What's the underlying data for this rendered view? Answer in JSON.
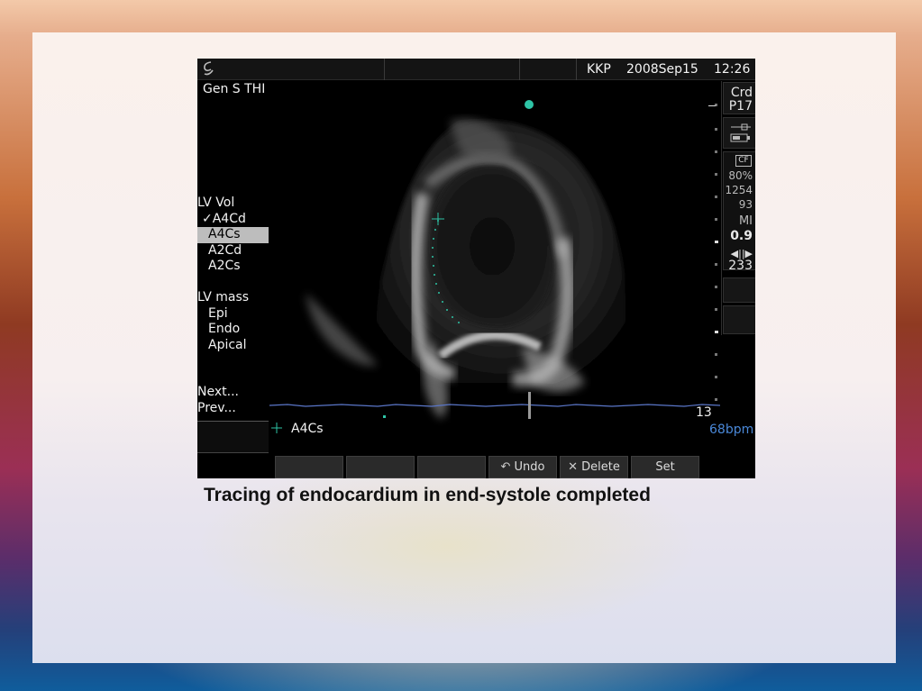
{
  "screen": {
    "operator": "KKP",
    "date": "2008Sep15",
    "time": "12:26",
    "mode": "Gen S THI",
    "menu": {
      "group1": {
        "title": "LV Vol",
        "items": [
          "✓A4Cd",
          "A4Cs",
          "A2Cd",
          "A2Cs"
        ],
        "selected": "A4Cs"
      },
      "group2": {
        "title": "LV mass",
        "items": [
          "Epi",
          "Endo",
          "Apical"
        ]
      },
      "nav": [
        "Next...",
        "Prev..."
      ]
    },
    "sidebar": {
      "preset": "Crd",
      "probe": "P17",
      "cf_label": "CF",
      "cf_values": [
        "80%",
        "1254",
        "93"
      ],
      "mi_label": "MI",
      "mi_value": "0.9",
      "depth_icon": "◀||▶",
      "depth_value": "233"
    },
    "cursor_label": "A4Cs",
    "frame_number": "13",
    "heart_rate": "68bpm",
    "softkeys": {
      "undo": "Undo",
      "delete": "Delete",
      "set": "Set"
    },
    "colors": {
      "accent_green": "#2ec4a6",
      "hr_blue": "#4a88d8",
      "ecg_blue": "#5a76c8"
    }
  },
  "caption": "Tracing of endocardium in end-systole completed"
}
